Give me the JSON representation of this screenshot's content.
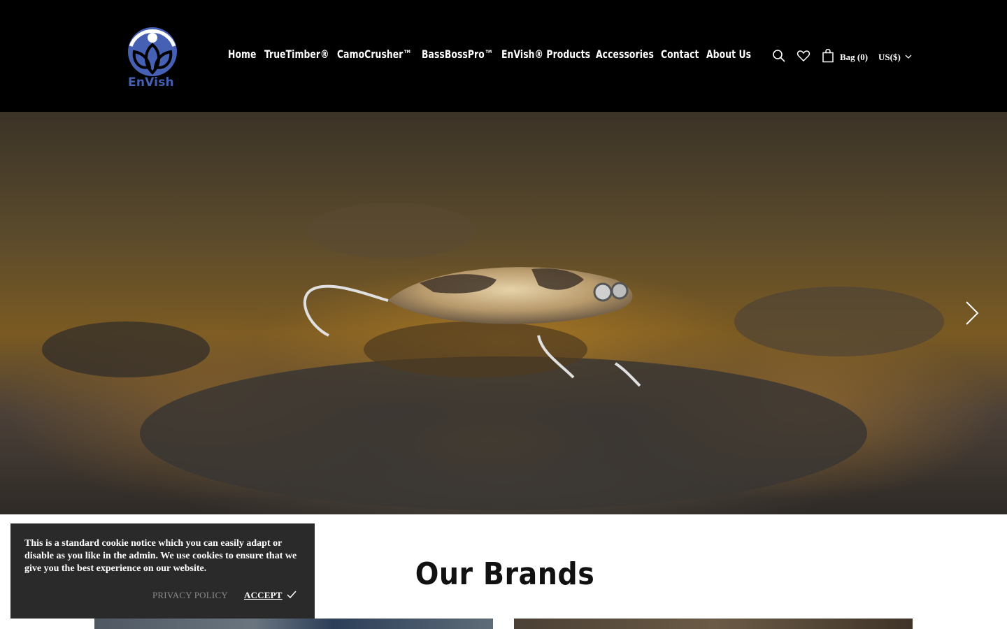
{
  "brand": {
    "logo_text": "EnVish",
    "logo_mark": "envish-leaf-logo"
  },
  "nav": [
    {
      "label": "Home"
    },
    {
      "label": "TrueTimber®"
    },
    {
      "label": "CamoCrusher™"
    },
    {
      "label": "BassBossPro™"
    },
    {
      "label": "EnVish® Products"
    },
    {
      "label": "Accessories"
    },
    {
      "label": "Contact"
    },
    {
      "label": "About Us"
    }
  ],
  "header_icons": {
    "search": "search-icon",
    "wishlist": "heart-icon",
    "bag": "bag-icon"
  },
  "bag": {
    "label": "Bag (0)"
  },
  "currency": {
    "label": "US($)"
  },
  "hero": {
    "next_label": "next-slide",
    "prev_label": "previous-slide"
  },
  "brands": {
    "title": "Our Brands"
  },
  "cookie": {
    "text": "This is a standard cookie notice which you can easily adapt or disable as you like in the admin. We use cookies to ensure that we give you the best experience on our website.",
    "privacy_label": "PRIVACY POLICY",
    "accept_label": "ACCEPT"
  },
  "colors": {
    "header_bg": "#000000",
    "logo_blue": "#4660b4",
    "cookie_bg": "#2a2a2a"
  }
}
